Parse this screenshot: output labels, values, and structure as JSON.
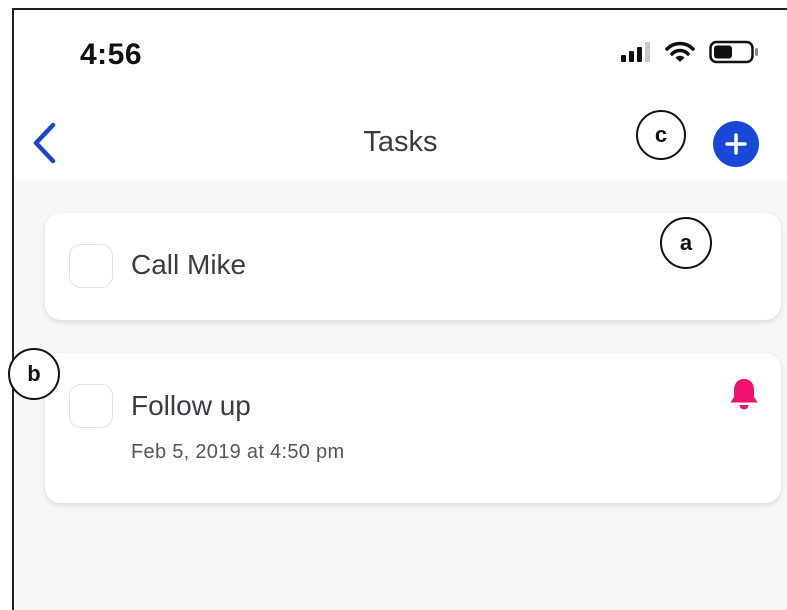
{
  "status_bar": {
    "time": "4:56",
    "icons": [
      "cellular-signal-icon",
      "wifi-icon",
      "battery-icon"
    ]
  },
  "nav": {
    "back_icon": "chevron-left-icon",
    "title": "Tasks",
    "add_icon": "plus-icon"
  },
  "tasks": [
    {
      "title": "Call Mike",
      "date": "",
      "has_reminder": false,
      "checked": false
    },
    {
      "title": "Follow up",
      "date": "Feb 5, 2019 at 4:50 pm",
      "has_reminder": true,
      "checked": false
    }
  ],
  "markers": {
    "a": "a",
    "b": "b",
    "c": "c"
  },
  "colors": {
    "accent_blue": "#1749d6",
    "reminder_pink": "#f0126f",
    "background": "#f7f6f8",
    "card": "#ffffff"
  }
}
